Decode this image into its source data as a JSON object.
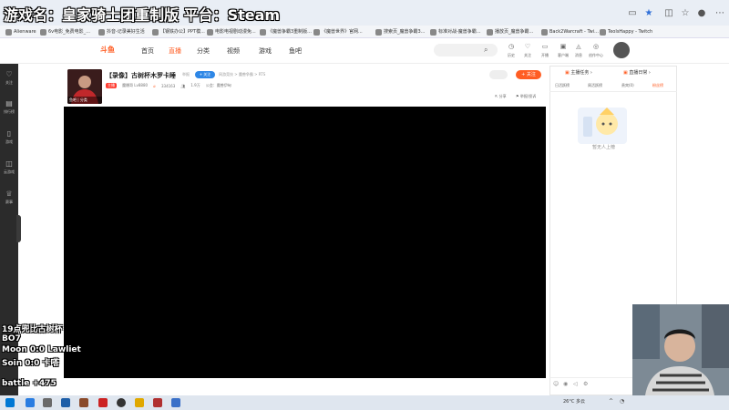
{
  "overlay_title": "游戏名：皇家骑士团重制版 平台：Steam",
  "bookmarks": [
    "Alienware",
    "6v电影_免费电影_...",
    "抖音-记录美好生活",
    "【钢铁办公】PPT模...",
    "电影电视剧动漫免...",
    "《魔兽争霸3重制版...",
    "《魔兽世界》官网...",
    "搜索页_魔兽争霸3...",
    "标准对战-魔兽争霸...",
    "播放页_魔兽争霸...",
    "Back2Warcraft - Twi...",
    "TeoIsHappy - Twitch"
  ],
  "site": {
    "logo": "斗鱼",
    "nav": [
      "首页",
      "直播",
      "分类",
      "视频",
      "游戏",
      "鱼吧"
    ],
    "header_icons": [
      {
        "icon": "history-icon",
        "label": "历史"
      },
      {
        "icon": "follow-icon",
        "label": "关注"
      },
      {
        "icon": "live-icon",
        "label": "开播"
      },
      {
        "icon": "gift-icon",
        "label": "客户端"
      },
      {
        "icon": "bell-icon",
        "label": "消息"
      },
      {
        "icon": "bulb-icon",
        "label": "创作中心"
      }
    ]
  },
  "sidebar": [
    {
      "icon": "heart-icon",
      "label": "关注"
    },
    {
      "icon": "rank-icon",
      "label": "排行榜"
    },
    {
      "icon": "mouse-icon",
      "label": "游戏"
    },
    {
      "icon": "gamepad-icon",
      "label": "云游戏"
    },
    {
      "icon": "trophy-icon",
      "label": "赛事"
    }
  ],
  "room": {
    "avatar_label": "鱼吧 | 分类",
    "title": "【录像】古树杯木罗卡睡",
    "tag": "举报",
    "follow_mini": "+ 关注",
    "category": "网游竞技 > 魔兽争霸 > RTS",
    "live_badge": "主播",
    "meta": [
      "魔爆哥 Lv8880",
      "334163",
      "1.9万",
      "公会：魔兽伊甸"
    ],
    "follow_button": "关注",
    "share": "分享",
    "report": "举报/投诉"
  },
  "right_panel": {
    "top": [
      "主播任务",
      "直播日常"
    ],
    "tabs": [
      "日活跃榜",
      "周活跃榜",
      "贵宾(0)",
      "粉丝榜"
    ],
    "empty_text": "暂无人上榜"
  },
  "overlay_lines": [
    "19点兜比古树杯",
    "BO7",
    "Moon 0:0 Lawliet",
    "Soin   0:0 卡嗒",
    "battle +475"
  ],
  "taskbar": {
    "weather": "26°C 多云"
  },
  "colors": {
    "accent": "#ff5d23",
    "sidebar": "#2b2b2b",
    "video": "#000000"
  }
}
